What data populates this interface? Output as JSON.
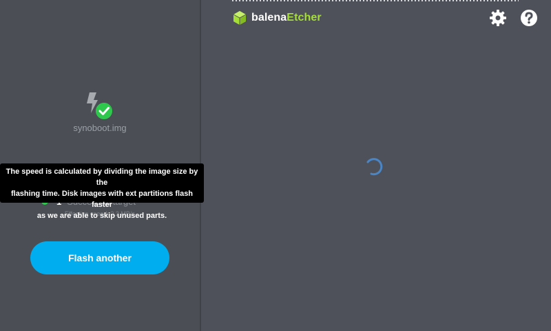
{
  "app": {
    "brand_prefix": "balena",
    "brand_suffix": "Etcher",
    "brand_color": "#a5de37",
    "accent_color": "#00aeef"
  },
  "header": {
    "settings_icon": "gear-icon",
    "help_icon": "help-icon"
  },
  "image": {
    "filename": "synoboot.img",
    "icon": "image-file-check-icon"
  },
  "result": {
    "success_count": "1",
    "success_label": "Successful target",
    "status_color": "#2ec94c",
    "speed": "Effective speed: 2.2 MB/s"
  },
  "tooltip": {
    "line1": "The speed is calculated by dividing the image size by the",
    "line2": "flashing time. Disk images with ext partitions flash faster",
    "line3": "as we are able to skip unused parts."
  },
  "actions": {
    "flash_another": "Flash another"
  },
  "main": {
    "loading_icon": "spinner-icon"
  }
}
